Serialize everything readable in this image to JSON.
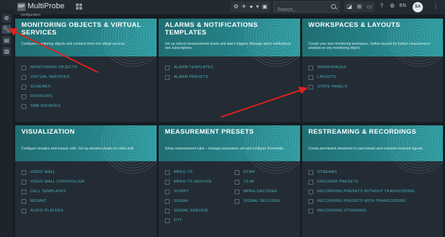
{
  "header": {
    "logo_text": "MP",
    "app_name": "MultiProbe",
    "search_placeholder": "Search...",
    "language": "EN",
    "avatar_initials": "SA",
    "toolbar_icons": [
      "dashboard-icon",
      "airplane-icon",
      "status-icon",
      "chevron-down-icon",
      "ticket-icon"
    ],
    "right_icons": [
      "alert-icon",
      "network-icon",
      "monitor-icon",
      "help-icon",
      "settings-icon"
    ]
  },
  "breadcrumb": "configuration",
  "rail": {
    "items": [
      "gear-icon",
      "wrench-icon",
      "chat-icon",
      "image-icon"
    ]
  },
  "cards": [
    {
      "title": "MONITORING OBJECTS & VIRTUAL SERVICES",
      "desc": "Configure monitoring objects and combine them into virtual services.",
      "items": [
        "MONITORING OBJECTS",
        "VIRTUAL SERVICES",
        "SCHEMES",
        "ROTATORS",
        "SMB SOURCES"
      ]
    },
    {
      "title": "ALARMS & NOTIFICATIONS TEMPLATES",
      "desc": "Set up critical measurements levels and alarm triggers. Manage alarm notifications and subscriptions.",
      "items": [
        "ALARM TEMPLATES",
        "ALARM PRESETS"
      ]
    },
    {
      "title": "WORKSPACES & LAYOUTS",
      "desc": "Create your own monitoring workspace. Define layouts for further measurement analysis on any monitoring object.",
      "items": [
        "WORKSPACES",
        "LAYOUTS",
        "STATE PANELS"
      ]
    },
    {
      "title": "VISUALIZATION",
      "desc": "Configure mosaics and mosaic cells. Set up streams shown on video wall.",
      "items": [
        "VIDEO WALL",
        "VIDEO WALL CONTROLLER",
        "CELL TEMPLATES",
        "MOSAIC",
        "AUDIO PLAYERS"
      ]
    },
    {
      "title": "MEASUREMENT PRESETS",
      "desc": "Setup measurement rules – manage parameters set and configure thresholds.",
      "items": [
        "MPEG-TS",
        "MPEG-TS SERVICE",
        "SCRIPT",
        "SIGNAL",
        "SIGNAL SERVICE",
        "OTT"
      ],
      "items2": [
        "RTMP",
        "T2-MI",
        "MPEG DECODER",
        "SIGNAL DECODER"
      ]
    },
    {
      "title": "RESTREAMING & RECORDINGS",
      "desc": "Create permanent streamers to cast mosaic and restream received signals",
      "items": [
        "STREAMS",
        "ENCODER PRESETS",
        "RECORDING PRESETS WITHOUT TRANSCODING",
        "RECORDING PRESETS WITH TRANSCODING",
        "RECORDING STORAGES"
      ]
    }
  ],
  "colors": {
    "accent": "#2b9aa0",
    "link": "#4ab6bc",
    "annotation_arrow": "#e0201c"
  }
}
